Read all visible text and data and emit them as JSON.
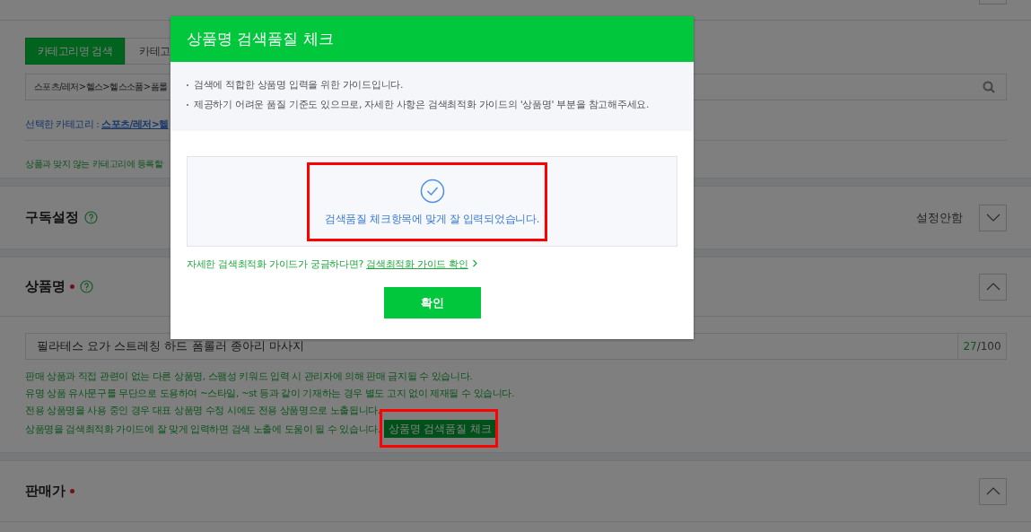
{
  "page": {
    "category_section": {
      "tabs": [
        {
          "label": "카테고리명 검색",
          "selected": true
        },
        {
          "label": "카테고",
          "selected": false
        }
      ],
      "search": {
        "value": "스포츠/레저>헬스>헬스소품>폼롤"
      },
      "selected_category": {
        "label": "선택한 카테고리 : ",
        "path": "스포츠/레저>헬"
      },
      "notice": "상품과 맞지 않는 카테고리에 등록할"
    },
    "subscription_section": {
      "title": "구독설정",
      "value": "설정안함",
      "expanded": false
    },
    "product_name_section": {
      "title": "상품명",
      "required": true,
      "expanded": true,
      "input": {
        "value": "필라테스 요가 스트레칭 하드 폼롤러 종아리 마사지",
        "count": "27",
        "max": "/100"
      },
      "notes": [
        "판매 상품과 직접 관련이 없는 다른 상품명, 스팸성 키워드 입력 시 관리자에 의해 판매 금지될 수 있습니다.",
        "유명 상품 유사문구를 무단으로 도용하여 ~스타일, ~st 등과 같이 기재하는 경우 별도 고지 없이 제재될 수 있습니다.",
        "전용 상품명을 사용 중인 경우 대표 상품명 수정 시에도 전용 상품명으로 노출됩니다.",
        "상품명을 검색최적화 가이드에 잘 맞게 입력하면 검색 노출에 도움이 될 수 있습니다."
      ],
      "check_button": "상품명 검색품질 체크"
    },
    "price_section": {
      "title": "판매가",
      "required": true,
      "expanded": true
    }
  },
  "dialog": {
    "title": "상품명 검색품질 체크",
    "guides": [
      "검색에 적합한 상품명 입력을 위한 가이드입니다.",
      "제공하기 어려운 품질 기준도 있으므로, 자세한 사항은 검색최적화 가이드의 '상품명' 부분을 참고해주세요."
    ],
    "result": "검색품질 체크항목에 맞게 잘 입력되었습니다.",
    "guide_prompt": "자세한 검색최적화 가이드가 궁금하다면? ",
    "guide_link": "검색최적화 가이드 확인",
    "confirm_button": "확인"
  }
}
